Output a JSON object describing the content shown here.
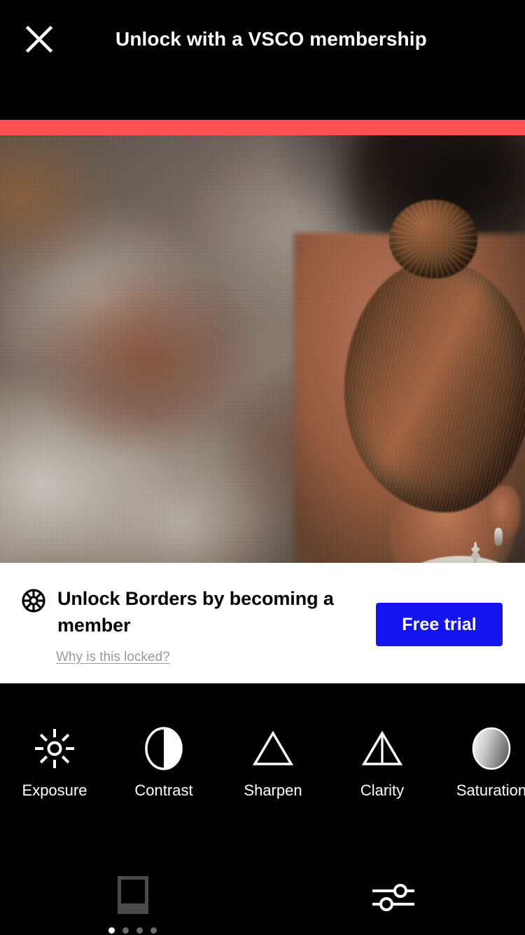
{
  "header": {
    "title": "Unlock with a VSCO membership",
    "close_icon": "close-icon"
  },
  "accent": {
    "color": "#fa5252"
  },
  "photo": {
    "alt": "Blurred photo of a tennis player with hair in a bun kissing a silver trophy",
    "icon": "photo-preview"
  },
  "unlock_card": {
    "tool_icon": "borders-wheel-icon",
    "title": "Unlock Borders by becoming a member",
    "why_link": "Why is this locked?",
    "cta_label": "Free trial",
    "cta_color": "#1414f0"
  },
  "tools": [
    {
      "label": "Exposure",
      "icon": "brightness-sun-icon"
    },
    {
      "label": "Contrast",
      "icon": "contrast-half-circle-icon"
    },
    {
      "label": "Sharpen",
      "icon": "sharpen-triangle-icon"
    },
    {
      "label": "Clarity",
      "icon": "clarity-triangle-line-icon"
    },
    {
      "label": "Saturation",
      "icon": "saturation-gradient-circle-icon"
    }
  ],
  "bottom_nav": {
    "borders_icon": "borders-frame-icon",
    "adjust_icon": "adjust-sliders-icon",
    "page_dots": 4,
    "active_dot": 1
  }
}
